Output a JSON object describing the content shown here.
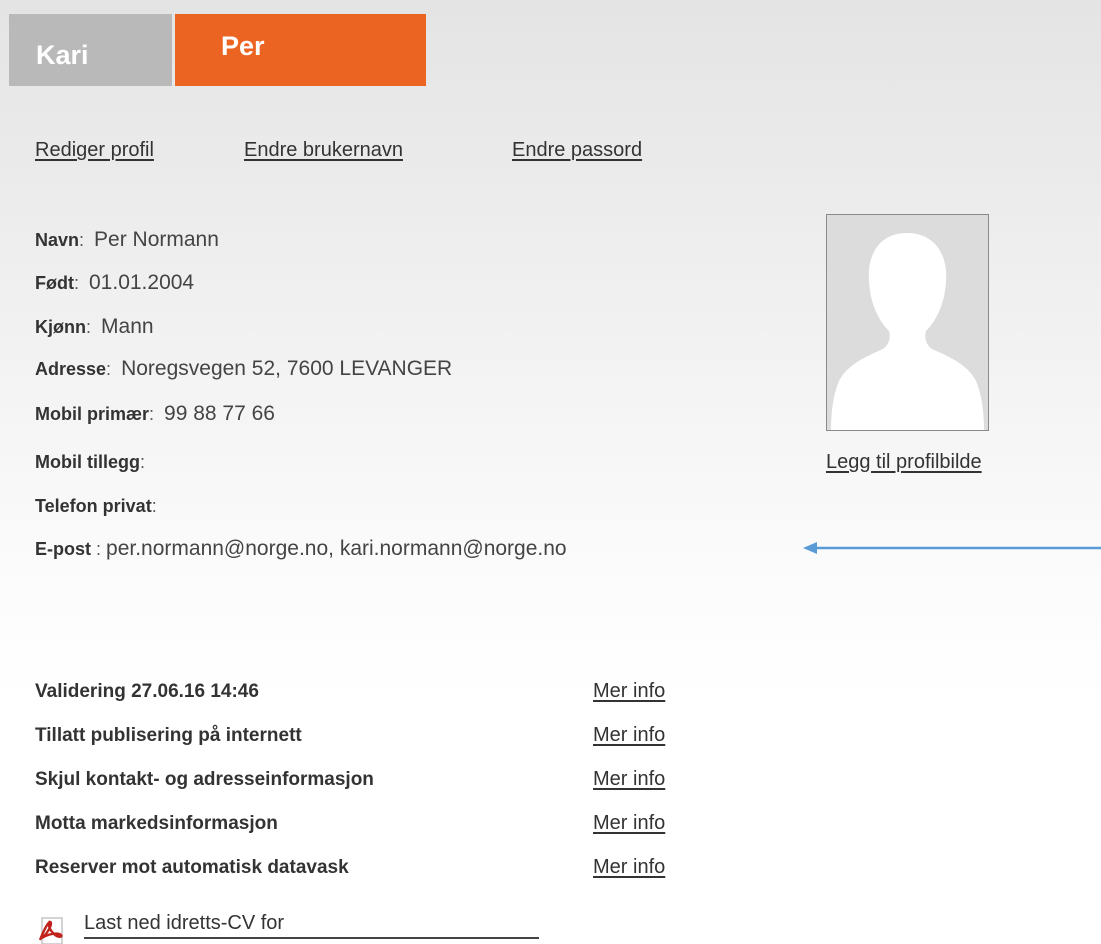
{
  "tabs": [
    {
      "label": "Kari",
      "color": "#b9b9b9"
    },
    {
      "label": "Per",
      "color": "#ec6422"
    }
  ],
  "profile_links": {
    "edit_profile": "Rediger profil",
    "change_username": "Endre brukernavn",
    "change_password": "Endre passord"
  },
  "profile": {
    "name": {
      "label": "Navn",
      "value": "Per Normann"
    },
    "born": {
      "label": "Født",
      "value": "01.01.2004"
    },
    "gender": {
      "label": "Kjønn",
      "value": "Mann"
    },
    "address": {
      "label": "Adresse",
      "value": "Noregsvegen 52, 7600 LEVANGER"
    },
    "mobile_primary": {
      "label": "Mobil primær",
      "value": "99 88 77 66"
    },
    "mobile_extra": {
      "label": "Mobil tillegg",
      "value": ""
    },
    "phone_private": {
      "label": "Telefon privat",
      "value": ""
    },
    "email": {
      "label": "E-post",
      "value": "per.normann@norge.no, kari.normann@norge.no"
    }
  },
  "avatar": {
    "add_picture_label": "Legg til profilbilde",
    "icon": "silhouette-icon"
  },
  "annotation": {
    "arrow_color": "#5b9bd5",
    "icon": "arrow-left-icon"
  },
  "settings": [
    {
      "label": "Validering 27.06.16 14:46",
      "link": "Mer info"
    },
    {
      "label": "Tillatt publisering på internett",
      "link": "Mer info"
    },
    {
      "label": "Skjul kontakt- og adresseinformasjon",
      "link": "Mer info"
    },
    {
      "label": "Motta markedsinformasjon",
      "link": "Mer info"
    },
    {
      "label": "Reserver mot automatisk datavask",
      "link": "Mer info"
    }
  ],
  "download": {
    "label": "Last ned idretts-CV for",
    "icon": "pdf-icon"
  },
  "colors": {
    "accent": "#ec6422",
    "inactive_tab": "#b9b9b9",
    "text": "#333333"
  }
}
